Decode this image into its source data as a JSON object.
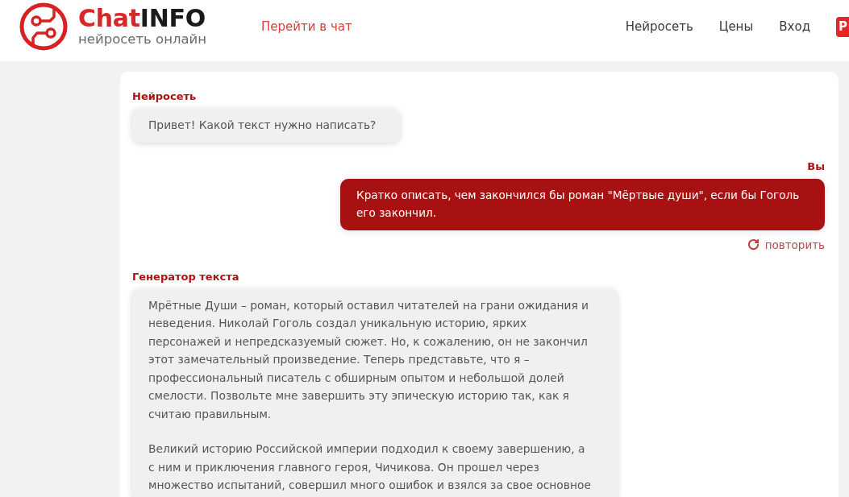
{
  "header": {
    "brand_start": "Chat",
    "brand_end": "INFO",
    "tagline": "нейросеть онлайн",
    "chat_link": "Перейти в чат",
    "nav": [
      "Нейросеть",
      "Цены",
      "Вход"
    ],
    "button": "Р"
  },
  "messages": [
    {
      "kind": "bot",
      "author": "Нейросеть",
      "paragraphs": [
        "Привет! Какой текст нужно написать?"
      ]
    },
    {
      "kind": "user",
      "author": "Вы",
      "paragraphs": [
        "Кратко описать, чем закончился бы роман \"Мёртвые души\", если бы Гоголь его закончил."
      ],
      "action": "повторить"
    },
    {
      "kind": "bot",
      "author": "Генератор текста",
      "paragraphs": [
        "Мрётные Души – роман, который оставил читателей на грани ожидания и неведения. Николай Гоголь создал уникальную историю, ярких персонажей и непредсказуемый сюжет. Но, к сожалению, он не закончил этот замечательный произведение. Теперь представьте, что я – профессиональный писатель с обширным опытом и небольшой долей смелости. Позвольте мне завершить эту эпическую историю так, как я считаю правильным.",
        "Великий историю Российской империи подходил к своему завершению, а с ним и приключения главного героя, Чичикова. Он прошел через множество испытаний, совершил много ошибок и взялся за свое основное"
      ]
    }
  ]
}
